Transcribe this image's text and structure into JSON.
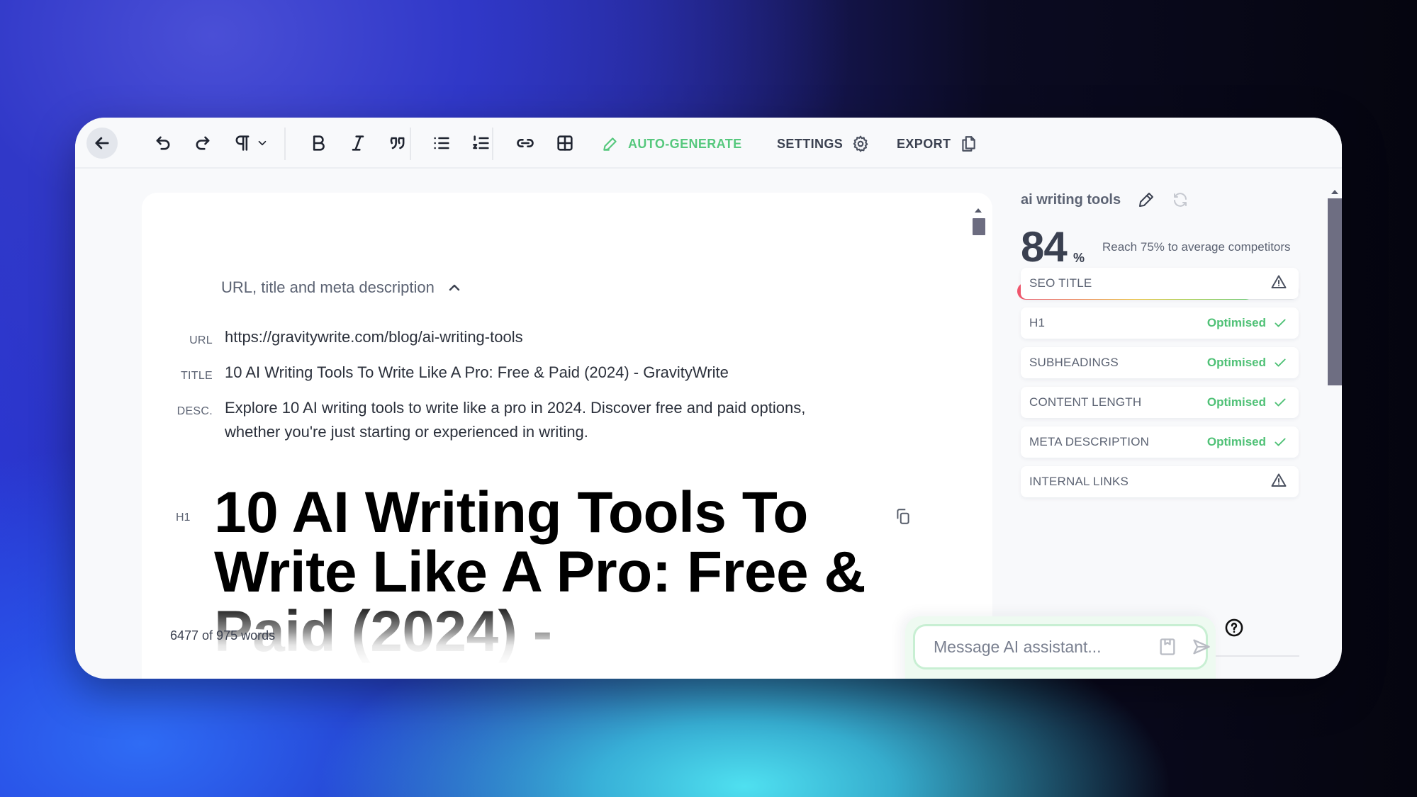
{
  "toolbar": {
    "back": "back",
    "tools": [
      "undo",
      "redo",
      "paragraph",
      "bold",
      "italic",
      "quote",
      "bullet-list",
      "numbered-list",
      "link",
      "table"
    ],
    "auto_generate_label": "AUTO-GENERATE",
    "settings_label": "SETTINGS",
    "export_label": "EXPORT"
  },
  "editor": {
    "meta_section_title": "URL, title and meta description",
    "meta": {
      "url_label": "URL",
      "url_value": "https://gravitywrite.com/blog/ai-writing-tools",
      "title_label": "TITLE",
      "title_value": "10 AI Writing Tools To Write Like A Pro: Free & Paid (2024) - GravityWrite",
      "desc_label": "DESC.",
      "desc_line1": "Explore 10 AI writing tools to write like a pro in 2024. Discover free and paid options,",
      "desc_line2": "whether you're just starting or experienced in writing."
    },
    "h1_label": "H1",
    "h1_text": "10 AI Writing Tools To Write Like A Pro: Free & Paid (2024) -",
    "word_count": "6477 of 975 words"
  },
  "sidebar": {
    "keyword": "ai writing tools",
    "score": "84",
    "score_unit": "%",
    "score_value": 84,
    "target_value": 75,
    "score_hint": "Reach 75% to average competitors",
    "checklist": [
      {
        "label": "SEO TITLE",
        "status": "",
        "state": "warning"
      },
      {
        "label": "H1",
        "status": "Optimised",
        "state": "ok"
      },
      {
        "label": "SUBHEADINGS",
        "status": "Optimised",
        "state": "ok"
      },
      {
        "label": "CONTENT LENGTH",
        "status": "Optimised",
        "state": "ok"
      },
      {
        "label": "META DESCRIPTION",
        "status": "Optimised",
        "state": "ok"
      },
      {
        "label": "INTERNAL LINKS",
        "status": "",
        "state": "warning"
      }
    ]
  },
  "chat": {
    "placeholder": "Message AI assistant..."
  },
  "colors": {
    "accent_green": "#56c87d",
    "ok_green": "#4fc176",
    "text_dark": "#1f2430",
    "text_muted": "#5c6373"
  }
}
